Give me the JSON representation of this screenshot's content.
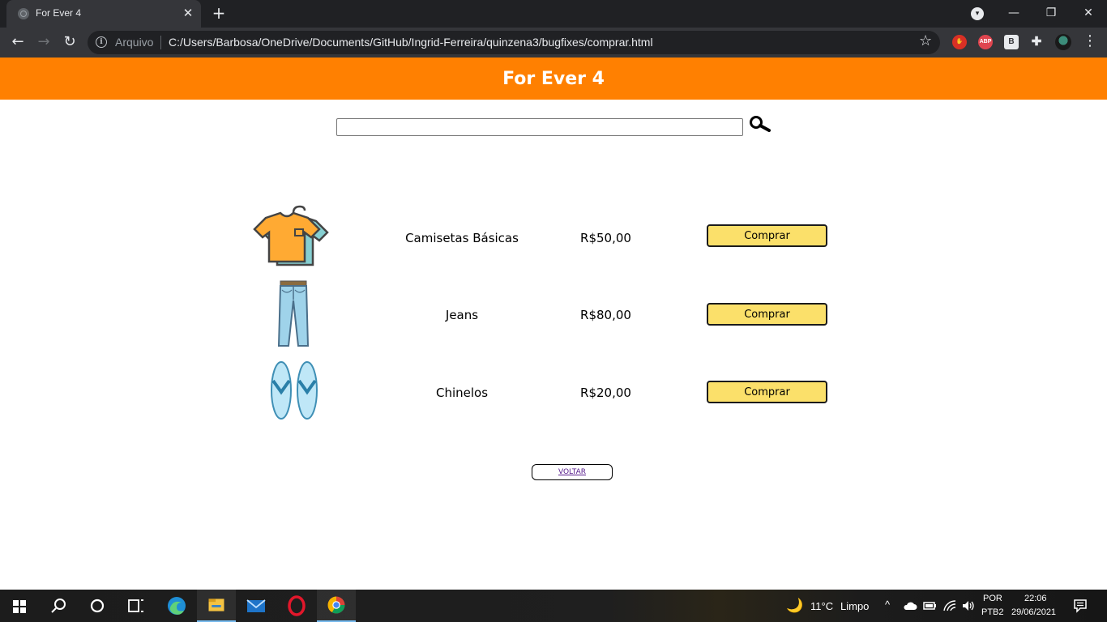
{
  "browser": {
    "tab_title": "For Ever 4",
    "omnibox_label": "Arquivo",
    "url": "C:/Users/Barbosa/OneDrive/Documents/GitHub/Ingrid-Ferreira/quinzena3/bugfixes/comprar.html",
    "extensions": [
      "stop-icon",
      "adblock-plus-icon",
      "b-extension-icon",
      "extensions-puzzle-icon",
      "profile-avatar"
    ],
    "ext_abp_label": "ABP",
    "ext_b_label": "B"
  },
  "page": {
    "title": "For Ever 4",
    "search": {
      "value": "",
      "placeholder": ""
    },
    "header_color": "#ff8001",
    "button_color": "#fbe06a",
    "products": [
      {
        "name": "Camisetas Básicas",
        "price": "R$50,00",
        "button": "Comprar",
        "image": "tshirt-icon"
      },
      {
        "name": "Jeans",
        "price": "R$80,00",
        "button": "Comprar",
        "image": "jeans-icon"
      },
      {
        "name": "Chinelos",
        "price": "R$20,00",
        "button": "Comprar",
        "image": "flip-flops-icon"
      }
    ],
    "back_label": "VOLTAR"
  },
  "taskbar": {
    "weather_temp": "11°C",
    "weather_desc": "Limpo",
    "lang_top": "POR",
    "lang_bottom": "PTB2",
    "time": "22:06",
    "date": "29/06/2021"
  }
}
